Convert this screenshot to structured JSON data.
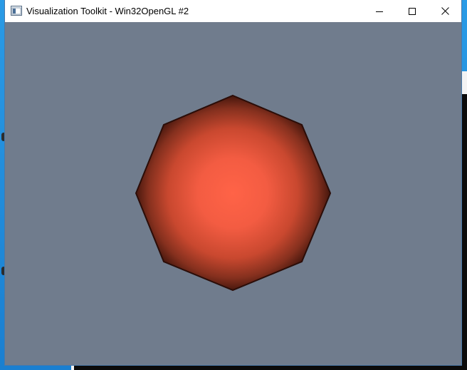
{
  "window": {
    "title": "Visualization Toolkit - Win32OpenGL #2",
    "background_color": "#707c8d"
  },
  "titlebar": {
    "app_icon": "vtk-window-icon",
    "buttons": [
      {
        "name": "minimize",
        "icon": "minimize-icon"
      },
      {
        "name": "maximize",
        "icon": "maximize-icon"
      },
      {
        "name": "close",
        "icon": "close-icon"
      }
    ]
  },
  "scene": {
    "object": "octagon-polygon",
    "center_color": "#ff6347",
    "edge_color": "#2b0d08",
    "sides": 8
  }
}
